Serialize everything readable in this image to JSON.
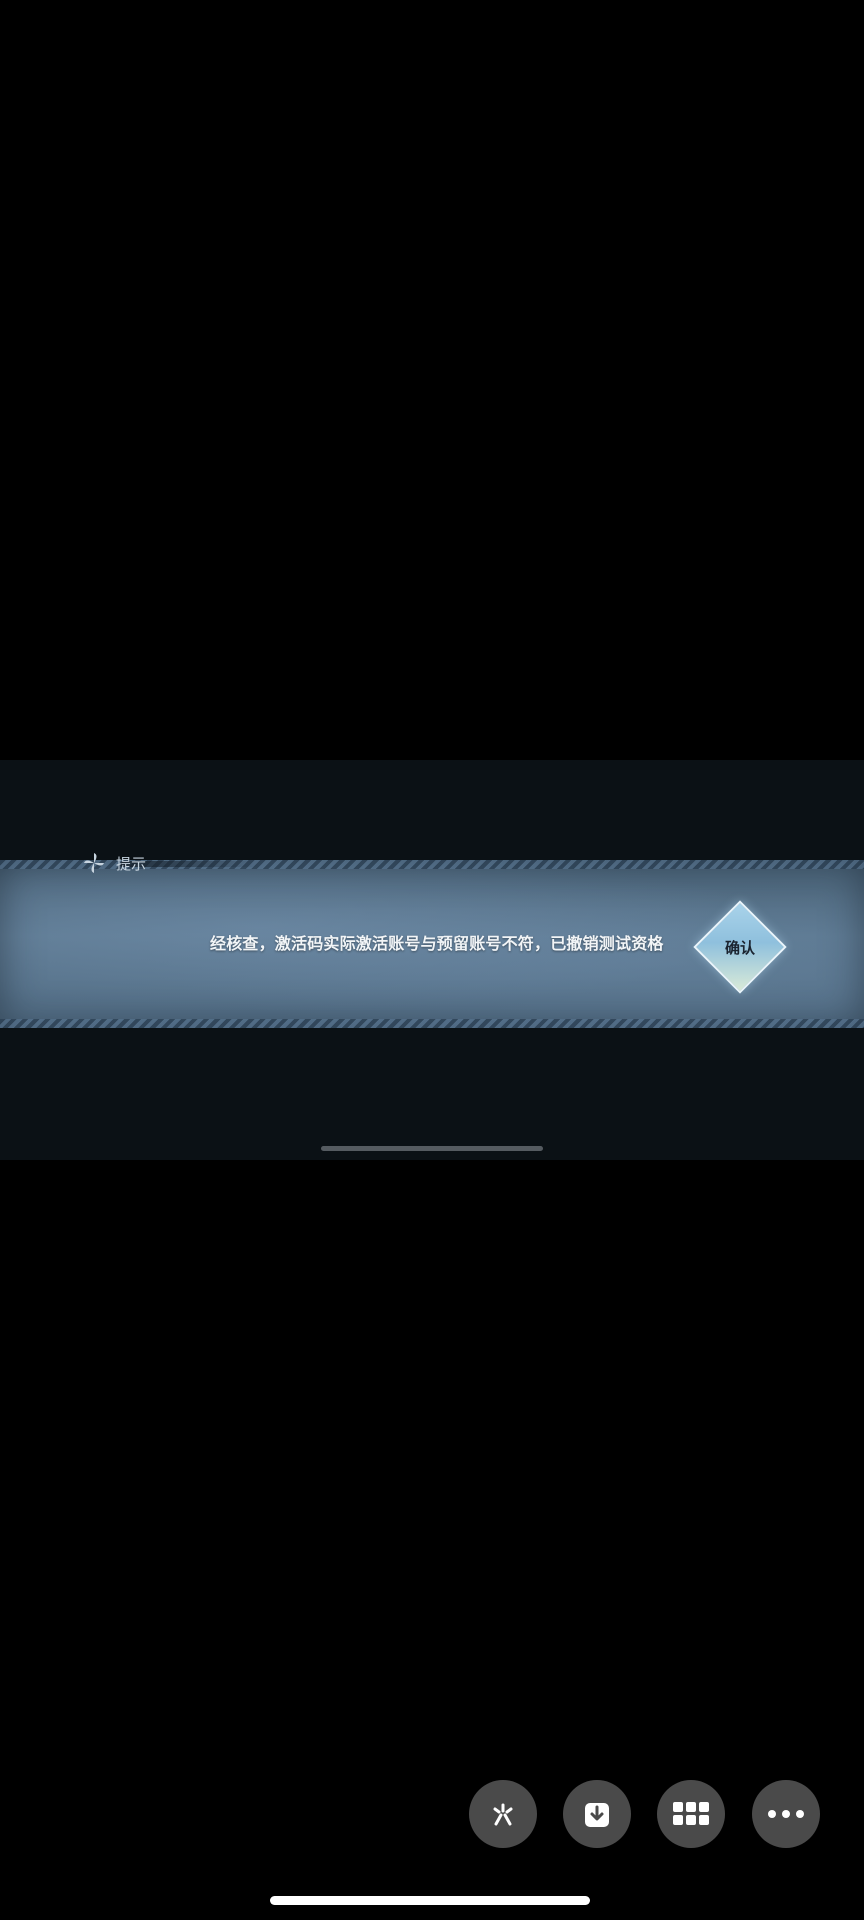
{
  "dialog": {
    "title": "提示",
    "message": "经核查，激活码实际激活账号与预留账号不符，已撤销测试资格",
    "confirm_label": "确认"
  },
  "actions": [
    {
      "name": "share",
      "icon": "share-icon"
    },
    {
      "name": "download",
      "icon": "download-icon"
    },
    {
      "name": "grid",
      "icon": "grid-icon"
    },
    {
      "name": "more",
      "icon": "more-icon"
    }
  ],
  "colors": {
    "background": "#000000",
    "banner": "#5c7890",
    "confirm": "#a9d3ea",
    "fab": "#4a4a4a"
  }
}
